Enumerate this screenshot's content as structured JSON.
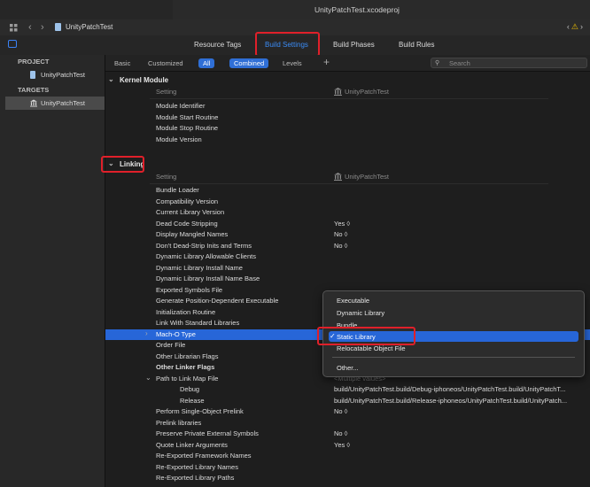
{
  "window": {
    "title": "UnityPatchTest.xcodeproj"
  },
  "navbar": {
    "breadcrumb": "UnityPatchTest",
    "back": "‹",
    "forward": "›",
    "right_controls": "‹ ▲ ›",
    "warn": "⚠"
  },
  "tabs": [
    "Resource Tags",
    "Build Settings",
    "Build Phases",
    "Build Rules"
  ],
  "sidebar": {
    "project_header": "PROJECT",
    "project_item": "UnityPatchTest",
    "targets_header": "TARGETS",
    "target_item": "UnityPatchTest"
  },
  "filters": {
    "basic": "Basic",
    "customized": "Customized",
    "all": "All",
    "combined": "Combined",
    "levels": "Levels",
    "plus": "+",
    "search_placeholder": "Search"
  },
  "kernel": {
    "title": "Kernel Module",
    "col_setting": "Setting",
    "col_target": "UnityPatchTest",
    "rows": [
      "Module Identifier",
      "Module Start Routine",
      "Module Stop Routine",
      "Module Version"
    ]
  },
  "linking": {
    "title": "Linking",
    "col_setting": "Setting",
    "col_target": "UnityPatchTest",
    "rows": [
      {
        "name": "Bundle Loader",
        "value": ""
      },
      {
        "name": "Compatibility Version",
        "value": ""
      },
      {
        "name": "Current Library Version",
        "value": ""
      },
      {
        "name": "Dead Code Stripping",
        "value": "Yes ◊"
      },
      {
        "name": "Display Mangled Names",
        "value": "No ◊"
      },
      {
        "name": "Don't Dead-Strip Inits and Terms",
        "value": "No ◊"
      },
      {
        "name": "Dynamic Library Allowable Clients",
        "value": ""
      },
      {
        "name": "Dynamic Library Install Name",
        "value": ""
      },
      {
        "name": "Dynamic Library Install Name Base",
        "value": ""
      },
      {
        "name": "Exported Symbols File",
        "value": ""
      },
      {
        "name": "Generate Position-Dependent Executable",
        "value": ""
      },
      {
        "name": "Initialization Routine",
        "value": ""
      },
      {
        "name": "Link With Standard Libraries",
        "value": ""
      },
      {
        "name": "Mach-O Type",
        "value": ""
      },
      {
        "name": "Order File",
        "value": ""
      },
      {
        "name": "Other Librarian Flags",
        "value": ""
      },
      {
        "name": "Other Linker Flags",
        "value": ""
      },
      {
        "name": "Path to Link Map File",
        "value": "<Multiple values>"
      },
      {
        "name": "Debug",
        "value": "build/UnityPatchTest.build/Debug-iphoneos/UnityPatchTest.build/UnityPatchT..."
      },
      {
        "name": "Release",
        "value": "build/UnityPatchTest.build/Release-iphoneos/UnityPatchTest.build/UnityPatch..."
      },
      {
        "name": "Perform Single-Object Prelink",
        "value": "No ◊"
      },
      {
        "name": "Prelink libraries",
        "value": ""
      },
      {
        "name": "Preserve Private External Symbols",
        "value": "No ◊"
      },
      {
        "name": "Quote Linker Arguments",
        "value": "Yes ◊"
      },
      {
        "name": "Re-Exported Framework Names",
        "value": ""
      },
      {
        "name": "Re-Exported Library Names",
        "value": ""
      },
      {
        "name": "Re-Exported Library Paths",
        "value": ""
      }
    ]
  },
  "popup": {
    "options": [
      "Executable",
      "Dynamic Library",
      "Bundle",
      "Static Library",
      "Relocatable Object File",
      "Other..."
    ],
    "selected": "Static Library",
    "check": "✓"
  },
  "colors": {
    "accent": "#2766d8",
    "highlight": "#e0202a",
    "active_tab": "#3b8cf6"
  }
}
